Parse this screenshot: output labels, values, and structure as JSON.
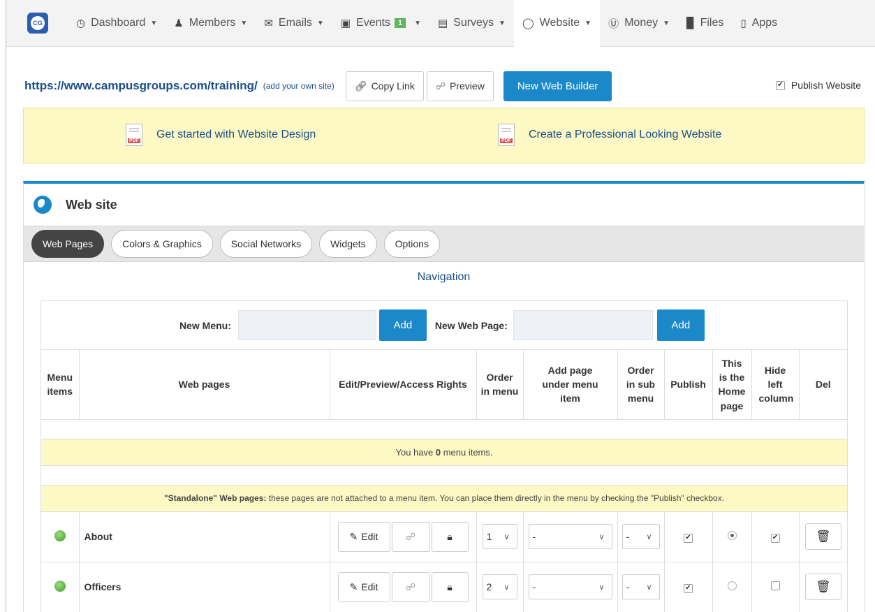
{
  "nav": {
    "logo": "CG",
    "items": [
      {
        "label": "Dashboard",
        "icon": "dashboard-icon",
        "caret": true
      },
      {
        "label": "Members",
        "icon": "user-icon",
        "caret": true
      },
      {
        "label": "Emails",
        "icon": "envelope-icon",
        "caret": true
      },
      {
        "label": "Events",
        "icon": "calendar-icon",
        "caret": true,
        "badge": "1"
      },
      {
        "label": "Surveys",
        "icon": "clipboard-icon",
        "caret": true
      },
      {
        "label": "Website",
        "icon": "globe-icon",
        "caret": true,
        "active": true
      },
      {
        "label": "Money",
        "icon": "coin-icon",
        "caret": true
      },
      {
        "label": "Files",
        "icon": "folder-icon",
        "caret": false
      },
      {
        "label": "Apps",
        "icon": "phone-icon",
        "caret": false
      }
    ]
  },
  "url_bar": {
    "url": "https://www.campusgroups.com/training/",
    "add_own": "(add your own site)",
    "copy_link": "Copy Link",
    "preview": "Preview",
    "new_builder": "New Web Builder",
    "publish_website": "Publish Website",
    "publish_checked": true
  },
  "banner": {
    "left": "Get started with Website Design",
    "right": "Create a Professional Looking Website",
    "pdf_label": "PDF"
  },
  "panel": {
    "title": "Web site",
    "tabs": [
      "Web Pages",
      "Colors & Graphics",
      "Social Networks",
      "Widgets",
      "Options"
    ],
    "active_tab": 0,
    "navigation_label": "Navigation",
    "new_menu_label": "New Menu:",
    "new_page_label": "New Web Page:",
    "add_label": "Add",
    "columns": {
      "menu_items": "Menu items",
      "web_pages": "Web pages",
      "edit_preview": "Edit/Preview/Access Rights",
      "order_menu": "Order in menu",
      "add_under": "Add page under menu item",
      "order_sub": "Order in sub menu",
      "publish": "Publish",
      "home": "This is the Home page",
      "hide_left": "Hide left column",
      "del": "Del"
    },
    "menu_msg_pre": "You have ",
    "menu_count": "0",
    "menu_msg_post": " menu items.",
    "standalone_bold": "\"Standalone\" Web pages:",
    "standalone_text": " these pages are not attached to a menu item. You can place them directly in the menu by checking the \"Publish\" checkbox.",
    "edit_label": "Edit",
    "pages": [
      {
        "name": "About",
        "order": "1",
        "under": "-",
        "sub": "-",
        "publish": true,
        "home": true,
        "hide_left": true
      },
      {
        "name": "Officers",
        "order": "2",
        "under": "-",
        "sub": "-",
        "publish": true,
        "home": false,
        "hide_left": false
      }
    ]
  }
}
